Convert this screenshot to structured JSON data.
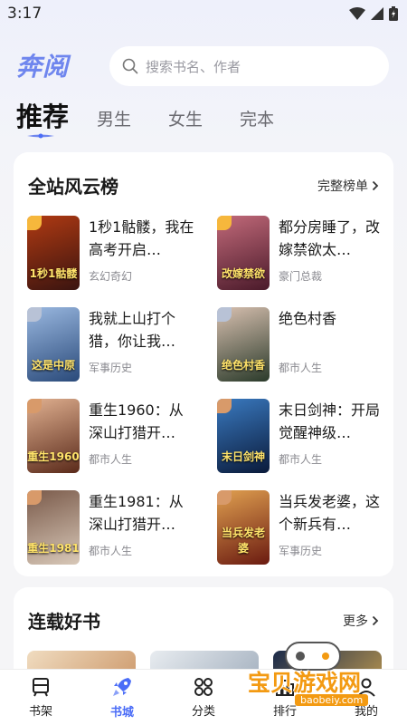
{
  "status_bar": {
    "time": "3:17"
  },
  "header": {
    "logo": "奔阅",
    "search_placeholder": "搜索书名、作者"
  },
  "tabs": [
    {
      "label": "推荐",
      "active": true
    },
    {
      "label": "男生"
    },
    {
      "label": "女生"
    },
    {
      "label": "完本"
    }
  ],
  "ranking": {
    "title": "全站风云榜",
    "more_label": "完整榜单",
    "books": [
      {
        "title": "1秒1骷髅，我在高考开启…",
        "category": "玄幻奇幻",
        "cover_text": "1秒1骷髅",
        "cover_colors": [
          "#3a1410",
          "#b03a12"
        ]
      },
      {
        "title": "都分房睡了，改嫁禁欲太…",
        "category": "豪门总裁",
        "cover_text": "改嫁禁欲",
        "cover_colors": [
          "#4a1a2a",
          "#c26a7a"
        ]
      },
      {
        "title": "我就上山打个猎，你让我…",
        "category": "军事历史",
        "cover_text": "这是中原",
        "cover_colors": [
          "#2a4a7a",
          "#9ab8e0"
        ]
      },
      {
        "title": "绝色村香",
        "category": "都市人生",
        "cover_text": "绝色村香",
        "cover_colors": [
          "#2a3a2a",
          "#d8c0b0"
        ]
      },
      {
        "title": "重生1960：从深山打猎开…",
        "category": "都市人生",
        "cover_text": "重生1960",
        "cover_colors": [
          "#5a2a1a",
          "#e0b090"
        ]
      },
      {
        "title": "末日剑神：开局觉醒神级…",
        "category": "都市人生",
        "cover_text": "末日剑神",
        "cover_colors": [
          "#0a1a3a",
          "#3a7ac0"
        ]
      },
      {
        "title": "重生1981：从深山打猎开…",
        "category": "都市人生",
        "cover_text": "重生1981",
        "cover_colors": [
          "#d8c8b8",
          "#7a5a4a"
        ]
      },
      {
        "title": "当兵发老婆，这个新兵有…",
        "category": "军事历史",
        "cover_text": "当兵发老婆",
        "cover_colors": [
          "#6a1a10",
          "#e0a050"
        ]
      }
    ]
  },
  "serial": {
    "title": "连载好书",
    "more_label": "更多"
  },
  "bottom_nav": [
    {
      "label": "书架",
      "icon": "bookshelf-icon"
    },
    {
      "label": "书城",
      "icon": "rocket-icon",
      "active": true
    },
    {
      "label": "分类",
      "icon": "category-icon"
    },
    {
      "label": "排行",
      "icon": "ranking-icon"
    },
    {
      "label": "我的",
      "icon": "profile-icon"
    }
  ],
  "watermark": {
    "text": "宝贝游戏网",
    "url": "baobeiy.com"
  },
  "colors": {
    "accent": "#4a6cf7",
    "logo": "#6f86ee",
    "watermark": "#f39a12"
  }
}
